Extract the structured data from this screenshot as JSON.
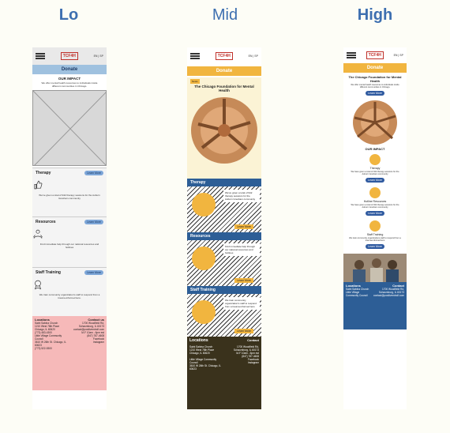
{
  "columns": {
    "lo": "Lo",
    "mid": "Mid",
    "high": "High"
  },
  "header": {
    "logo": "TCF4H",
    "lang": "EN | SP"
  },
  "lo": {
    "donate": "Donate",
    "impact_title": "OUR IMPACT",
    "impact_text": "We offer mental health resources to individuals inside different communities in Chicago.",
    "therapy": "Therapy",
    "therapy_text": "We've given a total of 942 therapy sessions for the Auburn Gresham community",
    "resources": "Resources",
    "resources_text": "Find immediate help through our national resources and hotlines",
    "staff": "Staff Training",
    "staff_text": "We train community organization's staff to respond from a trauma-informed lens.",
    "learn_more": "Learn More",
    "locations": "Locations",
    "contact": "Contact us",
    "loc1": "Saint Sabina Church",
    "loc1_addr": "1210 West 78th Place Chicago, IL 60620",
    "loc1_phone": "(773) 483-4300",
    "loc2": "Little Village Community Council",
    "loc2_addr": "3610 W 26th St. Chicago, IL 60623",
    "loc2_phone": "(773) 522-5300",
    "contact_addr": "1700 Woodfield Rd, Schaumburg, IL 60173",
    "contact_email": "contact@positivemindf.com",
    "contact_hours": "M-F 10am - 6pm est",
    "contact_phone": "(847) 787-4608",
    "facebook": "Facebook",
    "instagram": "Instagram"
  },
  "mid": {
    "donate": "Donate",
    "news": "News",
    "hero_title": "The Chicago Foundation for Mental Health",
    "therapy": "Therapy",
    "therapy_text": "We've given a total of 942 therapy sessions for the Auburn Gresham community",
    "resources": "Resources",
    "resources_text": "Find immediate help through our national resources and hotlines",
    "staff": "Staff Training",
    "staff_text": "We train community organization's staff to respond from a trauma-informed lens",
    "learn_more": "Learn More",
    "locations": "Locations",
    "contact": "Contact",
    "loc1": "Saint Sabina Church",
    "loc1_addr": "1210 West 78th Place Chicago, IL 60620",
    "loc2": "Little Village Community Council",
    "loc2_addr": "3610 W 26th St. Chicago, IL 60623",
    "contact_addr": "1700 Woodfield Rd, Schaumburg, IL 60173",
    "contact_hours": "M-F 10am - 6pm est",
    "contact_phone": "(847) 787-4608",
    "facebook": "Facebook",
    "instagram": "Instagram"
  },
  "high": {
    "donate": "Donate",
    "hero_title": "The Chicago Foundation for Mental Health",
    "hero_text": "We offer mental health resources to individuals inside different communities in Chicago.",
    "learn_more": "Learn More",
    "impact_title": "OUR IMPACT",
    "therapy": "Therapy",
    "therapy_text": "We have given a total of 942 therapy sessions for the Auburn Gresham community",
    "hotline": "Hotline Resources",
    "hotline_text": "We have given a total of 942 therapy sessions for the Auburn Gresham community",
    "staff": "Staff Training",
    "staff_text": "We train community organizations staff to respond from a trauma-informed lens",
    "locations": "Locations",
    "contact": "Contact",
    "loc1": "Saint Sabina Church",
    "loc2": "Little Village Community Council",
    "contact_addr": "1700 Woodfield Rd, Schaumburg, IL 60173",
    "contact_email": "contact@positivemindf.com"
  }
}
